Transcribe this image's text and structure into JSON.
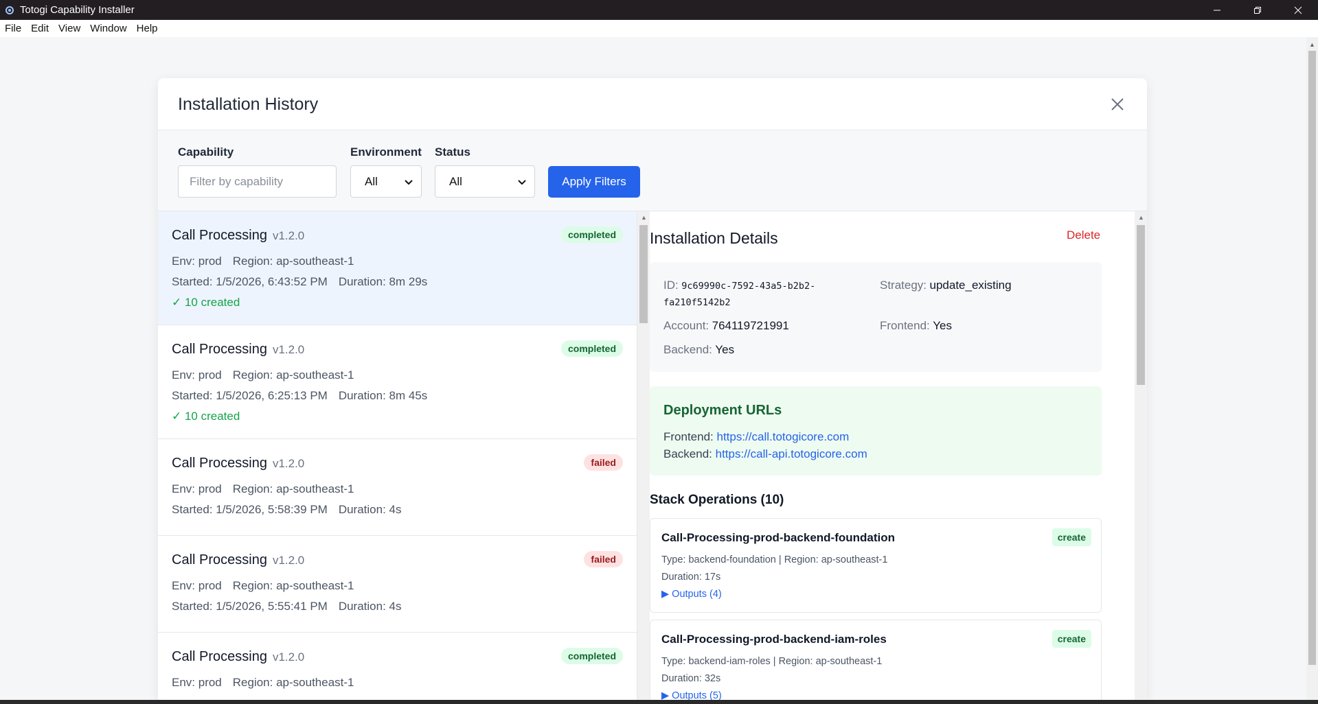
{
  "window": {
    "title": "Totogi Capability Installer"
  },
  "menu": [
    "File",
    "Edit",
    "View",
    "Window",
    "Help"
  ],
  "modal": {
    "title": "Installation History",
    "filters": {
      "capability_label": "Capability",
      "capability_placeholder": "Filter by capability",
      "capability_value": "",
      "environment_label": "Environment",
      "environment_value": "All",
      "status_label": "Status",
      "status_value": "All",
      "apply_label": "Apply Filters"
    }
  },
  "installations": [
    {
      "name": "Call Processing",
      "version": "v1.2.0",
      "status": "completed",
      "env": "Env: prod",
      "region": "Region: ap-southeast-1",
      "started": "Started: 1/5/2026, 6:43:52 PM",
      "duration": "Duration: 8m 29s",
      "created": "✓ 10 created",
      "selected": true
    },
    {
      "name": "Call Processing",
      "version": "v1.2.0",
      "status": "completed",
      "env": "Env: prod",
      "region": "Region: ap-southeast-1",
      "started": "Started: 1/5/2026, 6:25:13 PM",
      "duration": "Duration: 8m 45s",
      "created": "✓ 10 created"
    },
    {
      "name": "Call Processing",
      "version": "v1.2.0",
      "status": "failed",
      "env": "Env: prod",
      "region": "Region: ap-southeast-1",
      "started": "Started: 1/5/2026, 5:58:39 PM",
      "duration": "Duration: 4s"
    },
    {
      "name": "Call Processing",
      "version": "v1.2.0",
      "status": "failed",
      "env": "Env: prod",
      "region": "Region: ap-southeast-1",
      "started": "Started: 1/5/2026, 5:55:41 PM",
      "duration": "Duration: 4s"
    },
    {
      "name": "Call Processing",
      "version": "v1.2.0",
      "status": "completed",
      "env": "Env: prod",
      "region": "Region: ap-southeast-1"
    }
  ],
  "details": {
    "title": "Installation Details",
    "delete_label": "Delete",
    "id_label": "ID:",
    "id_line1": "9c69990c-7592-43a5-b2b2-",
    "id_line2": "fa210f5142b2",
    "strategy_label": "Strategy:",
    "strategy_value": "update_existing",
    "account_label": "Account:",
    "account_value": "764119721991",
    "frontend_label": "Frontend:",
    "frontend_value": "Yes",
    "backend_label": "Backend:",
    "backend_value": "Yes",
    "deployment": {
      "title": "Deployment URLs",
      "frontend_label": "Frontend:",
      "frontend_url": "https://call.totogicore.com",
      "backend_label": "Backend:",
      "backend_url": "https://call-api.totogicore.com"
    },
    "stack_title": "Stack Operations (10)",
    "stacks": [
      {
        "name": "Call-Processing-prod-backend-foundation",
        "meta": "Type: backend-foundation | Region: ap-southeast-1",
        "duration": "Duration: 17s",
        "outputs": "▶ Outputs (4)",
        "action": "create"
      },
      {
        "name": "Call-Processing-prod-backend-iam-roles",
        "meta": "Type: backend-iam-roles | Region: ap-southeast-1",
        "duration": "Duration: 32s",
        "outputs": "▶ Outputs (5)",
        "action": "create"
      }
    ]
  },
  "colors": {
    "accent": "#2563eb",
    "completed_bg": "#dcfce7",
    "failed_bg": "#fee2e2",
    "delete": "#dc2626"
  }
}
